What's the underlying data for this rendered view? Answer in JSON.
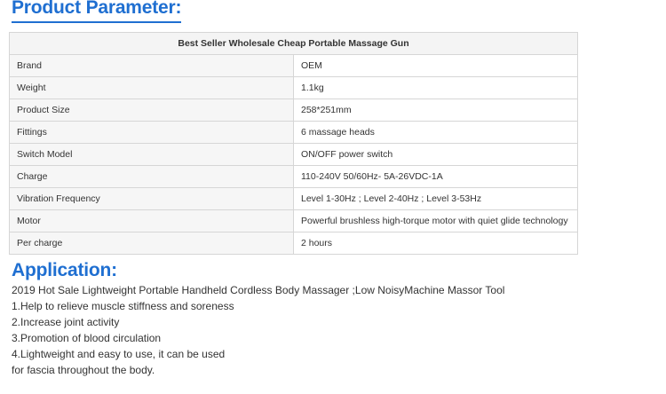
{
  "product_parameter": {
    "heading": "Product Parameter:",
    "table_title": "Best Seller Wholesale Cheap Portable Massage Gun",
    "rows": [
      {
        "label": "Brand",
        "value": "OEM"
      },
      {
        "label": "Weight",
        "value": "1.1kg"
      },
      {
        "label": "Product Size",
        "value": "258*251mm"
      },
      {
        "label": "Fittings",
        "value": "6 massage heads"
      },
      {
        "label": "Switch Model",
        "value": "ON/OFF power switch"
      },
      {
        "label": "Charge",
        "value": "110-240V 50/60Hz-  5A-26VDC-1A"
      },
      {
        "label": "Vibration Frequency",
        "value": "Level 1-30Hz ;  Level 2-40Hz ;  Level 3-53Hz"
      },
      {
        "label": "Motor",
        "value": "Powerful brushless high-torque motor with quiet glide technology"
      },
      {
        "label": "Per charge",
        "value": "2 hours"
      }
    ]
  },
  "application": {
    "heading": "Application:",
    "lines": [
      "2019 Hot Sale Lightweight  Portable Handheld Cordless Body Massager ;Low NoisyMachine Massor Tool",
      "1.Help to relieve muscle stiffness and soreness",
      "2.Increase joint activity",
      "3.Promotion of blood circulation",
      "4.Lightweight and easy to use, it can be used",
      "for fascia throughout the body."
    ]
  },
  "colors": {
    "heading_blue": "#1f6fd1",
    "border": "#d6d6d6",
    "label_bg": "#f6f6f6"
  }
}
